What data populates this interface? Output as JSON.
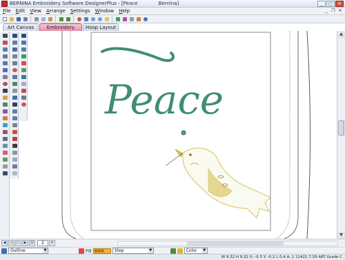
{
  "window": {
    "title": "BERNINA Embroidery Software DesignerPlus - [Peace",
    "title_suffix": "Bernina]"
  },
  "menu": {
    "items": [
      "File",
      "Edit",
      "View",
      "Arrange",
      "Settings",
      "Window",
      "Help"
    ]
  },
  "tabs": [
    {
      "label": "Art Canvas",
      "active": false
    },
    {
      "label": "Embroidery Canvas",
      "active": true
    },
    {
      "label": "Hoop Layout",
      "active": false
    }
  ],
  "canvas": {
    "design_text": "Peace",
    "text_color": "#3f8f73",
    "bird_color": "#c9bb4a"
  },
  "navigation": {
    "zoom_value": "2"
  },
  "property_bar": {
    "outline_label": "Outline",
    "fill_label": "Fill",
    "fill_type": "Step",
    "color_label": "Color"
  },
  "status": {
    "text": "W 9.32 H 9.32   X: -0.3 Y: -0.2 L   0.4 A: 1   11421   7.59   ART Grade C"
  },
  "colors": {
    "active_tab": "#e58ea9",
    "fill_swatch": "#f2b52c"
  }
}
